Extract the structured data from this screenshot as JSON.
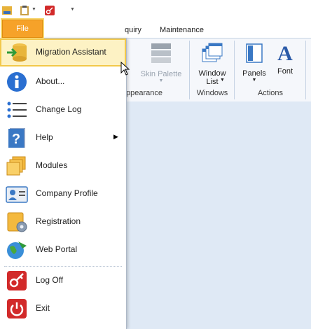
{
  "app": {
    "qat": {
      "icons": [
        "logo-icon",
        "clipboard-icon",
        "logoff-icon",
        "customize-icon"
      ]
    },
    "ribbon": {
      "tabs": {
        "inquiry": "quiry",
        "maintenance": "Maintenance"
      },
      "buttons": {
        "skin_palette": "Skin Palette",
        "window_list_line1": "Window",
        "window_list_line2": "List",
        "panels": "Panels",
        "font": "Font"
      },
      "groups": {
        "appearance": "ppearance",
        "windows": "Windows",
        "actions": "Actions"
      }
    },
    "file_tab": {
      "label": "File"
    },
    "menu": {
      "items": [
        {
          "label": "Migration Assistant",
          "icon": "migration-icon"
        },
        {
          "label": "About...",
          "icon": "info-icon"
        },
        {
          "label": "Change Log",
          "icon": "list-icon"
        },
        {
          "label": "Help",
          "icon": "help-icon"
        },
        {
          "label": "Modules",
          "icon": "modules-icon"
        },
        {
          "label": "Company Profile",
          "icon": "company-profile-icon"
        },
        {
          "label": "Registration",
          "icon": "registration-icon"
        },
        {
          "label": "Web Portal",
          "icon": "globe-icon"
        },
        {
          "label": "Log Off",
          "icon": "logoff-icon"
        },
        {
          "label": "Exit",
          "icon": "exit-icon"
        }
      ]
    }
  }
}
